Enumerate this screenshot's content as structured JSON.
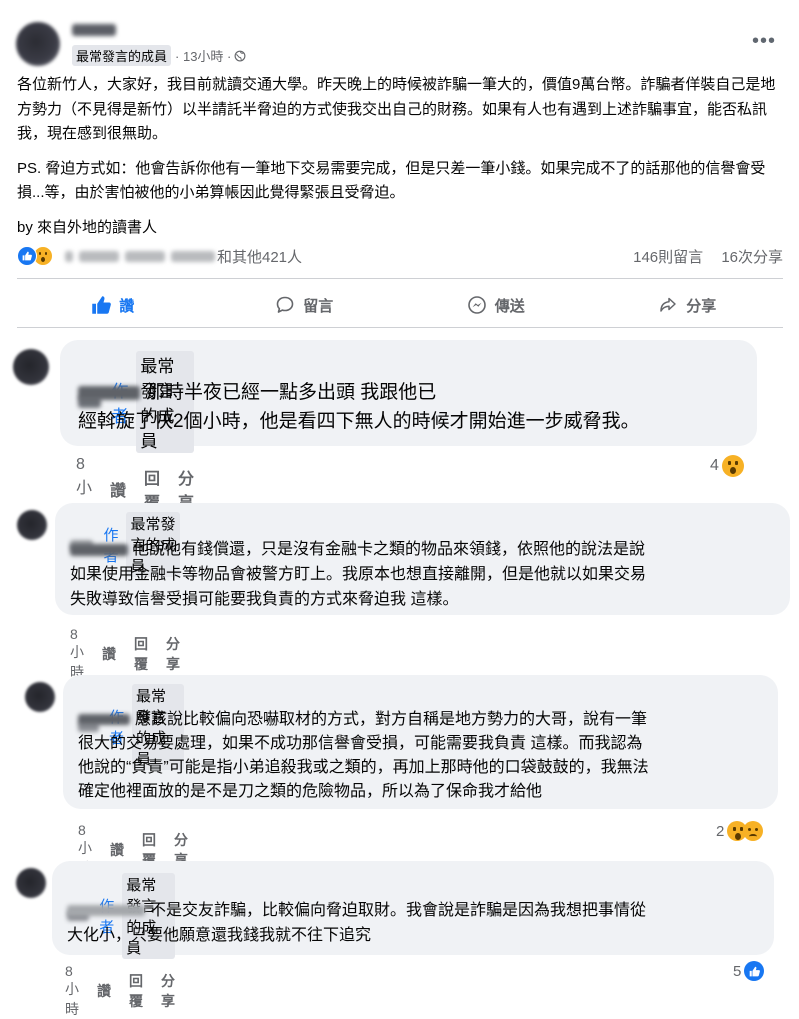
{
  "post": {
    "member_badge": "最常發言的成員",
    "time": "13小時",
    "more_icon": "more-horizontal-icon",
    "paragraphs": [
      "各位新竹人，大家好，我目前就讀交通大學。昨天晚上的時候被詐騙一筆大的，價值9萬台幣。詐騙者佯裝自己是地方勢力（不見得是新竹）以半請託半脅迫的方式使我交出自己的財務。如果有人也有遇到上述詐騙事宜，能否私訊我，現在感到很無助。",
      "PS. 脅迫方式如：他會告訴你他有一筆地下交易需要完成，但是只差一筆小錢。如果完成不了的話那他的信譽會受損...等，由於害怕被他的小弟算帳因此覺得緊張且受脅迫。",
      "by 來自外地的讀書人"
    ],
    "reactions": {
      "others_text": "和其他421人",
      "comments_count": "146則留言",
      "shares_count": "16次分享"
    },
    "actions": {
      "like": "讚",
      "comment": "留言",
      "send": "傳送",
      "share": "分享"
    }
  },
  "comments": [
    {
      "author_label": "作者",
      "member_badge": "最常發言的成員",
      "lines": [
        "那時半夜已經一點多出頭 我跟他已",
        "經斡旋了快2個小時，他是看四下無人的時候才開始進一步威脅我。"
      ],
      "time": "8小時",
      "like": "讚",
      "reply": "回覆",
      "share": "分享",
      "reaction_count": "4"
    },
    {
      "author_label": "作者",
      "member_badge": "最常發言的成員",
      "lines": [
        "他說他有錢償還，只是沒有金融卡之類的物品來領錢，依照他的說法是說",
        "如果使用金融卡等物品會被警方盯上。我原本也想直接離開，但是他就以如果交易",
        "失敗導致信譽受損可能要我負責的方式來脅迫我 這樣。"
      ],
      "time": "8小時",
      "like": "讚",
      "reply": "回覆",
      "share": "分享",
      "reaction_count": ""
    },
    {
      "author_label": "作者",
      "member_badge": "最常發言的成員",
      "lines": [
        "應該說比較偏向恐嚇取材的方式，對方自稱是地方勢力的大哥，說有一筆",
        "很大的交易要處理，如果不成功那信譽會受損，可能需要我負責 這樣。而我認為",
        "他說的“負責”可能是指小弟追殺我或之類的，再加上那時他的口袋鼓鼓的，我無法",
        "確定他裡面放的是不是刀之類的危險物品，所以為了保命我才給他"
      ],
      "time": "8小時",
      "like": "讚",
      "reply": "回覆",
      "share": "分享",
      "reaction_count": "2"
    },
    {
      "author_label": "作者",
      "member_badge": "最常發言的成員",
      "lines": [
        "不是交友詐騙，比較偏向脅迫取財。我會說是詐騙是因為我想把事情從",
        "大化小，只要他願意還我錢我就不往下追究"
      ],
      "time": "8小時",
      "like": "讚",
      "reply": "回覆",
      "share": "分享",
      "reaction_count": "5"
    }
  ],
  "colors": {
    "facebook_blue": "#1877f2",
    "secondary_text": "#65676b",
    "bubble_bg": "#f0f2f5"
  }
}
